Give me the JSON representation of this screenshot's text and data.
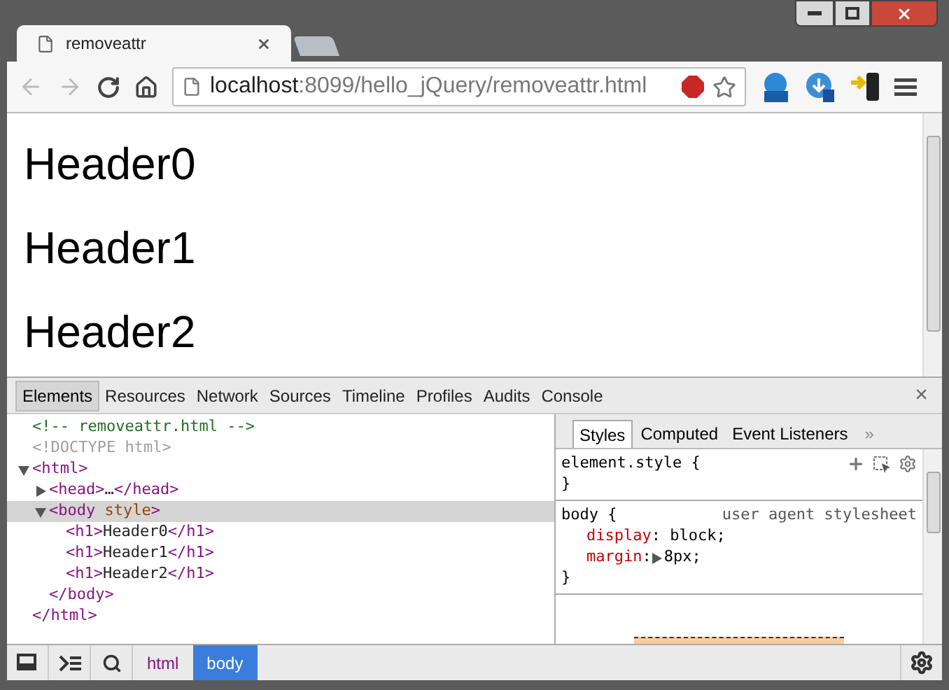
{
  "browser": {
    "tab_title": "removeattr",
    "url_host": "localhost",
    "url_rest": ":8099/hello_jQuery/removeattr.html"
  },
  "page": {
    "headers": [
      "Header0",
      "Header1",
      "Header2"
    ]
  },
  "devtools": {
    "tabs": [
      {
        "label": "Elements",
        "selected": true
      },
      {
        "label": "Resources",
        "selected": false
      },
      {
        "label": "Network",
        "selected": false
      },
      {
        "label": "Sources",
        "selected": false
      },
      {
        "label": "Timeline",
        "selected": false
      },
      {
        "label": "Profiles",
        "selected": false
      },
      {
        "label": "Audits",
        "selected": false
      },
      {
        "label": "Console",
        "selected": false
      }
    ],
    "close": "×",
    "dom": [
      {
        "segments": [
          {
            "kind": "comment",
            "text": "<!-- removeattr.html -->"
          }
        ]
      },
      {
        "segments": [
          {
            "kind": "doctype",
            "text": "<!DOCTYPE html>"
          }
        ]
      },
      {
        "segments": [
          {
            "kind": "tag",
            "text": "<html>"
          }
        ],
        "expanded": true,
        "selected": false,
        "close": "</html>",
        "children": [
          {
            "segments": [
              {
                "kind": "tag",
                "text": "<head>"
              },
              {
                "kind": "text",
                "text": "…"
              },
              {
                "kind": "tag",
                "text": "</head>"
              }
            ],
            "expanded": false,
            "selected": false
          },
          {
            "segments": [
              {
                "kind": "tag",
                "text": "<body"
              },
              {
                "kind": "attr",
                "text": " style"
              },
              {
                "kind": "tag",
                "text": ">"
              }
            ],
            "expanded": true,
            "selected": true,
            "close": "</body>",
            "children": [
              {
                "segments": [
                  {
                    "kind": "tag",
                    "text": "<h1>"
                  },
                  {
                    "kind": "text",
                    "text": "Header0"
                  },
                  {
                    "kind": "tag",
                    "text": "</h1>"
                  }
                ]
              },
              {
                "segments": [
                  {
                    "kind": "tag",
                    "text": "<h1>"
                  },
                  {
                    "kind": "text",
                    "text": "Header1"
                  },
                  {
                    "kind": "tag",
                    "text": "</h1>"
                  }
                ]
              },
              {
                "segments": [
                  {
                    "kind": "tag",
                    "text": "<h1>"
                  },
                  {
                    "kind": "text",
                    "text": "Header2"
                  },
                  {
                    "kind": "tag",
                    "text": "</h1>"
                  }
                ]
              }
            ]
          }
        ]
      }
    ],
    "style_tabs": [
      {
        "label": "Styles",
        "selected": true
      },
      {
        "label": "Computed",
        "selected": false
      },
      {
        "label": "Event Listeners",
        "selected": false
      }
    ],
    "style_tabs_more": "»",
    "rules": [
      {
        "selector": "element.style {",
        "close": "}"
      },
      {
        "selector": "body {",
        "source": "user agent stylesheet",
        "close": "}",
        "props": [
          {
            "name": "display",
            "punct": ":",
            "value": "block;",
            "expandable": false
          },
          {
            "name": "margin",
            "punct": ":",
            "value": "8px;",
            "expandable": true
          }
        ]
      }
    ],
    "breadcrumbs": [
      {
        "label": "html",
        "selected": false
      },
      {
        "label": "body",
        "selected": true
      }
    ]
  }
}
